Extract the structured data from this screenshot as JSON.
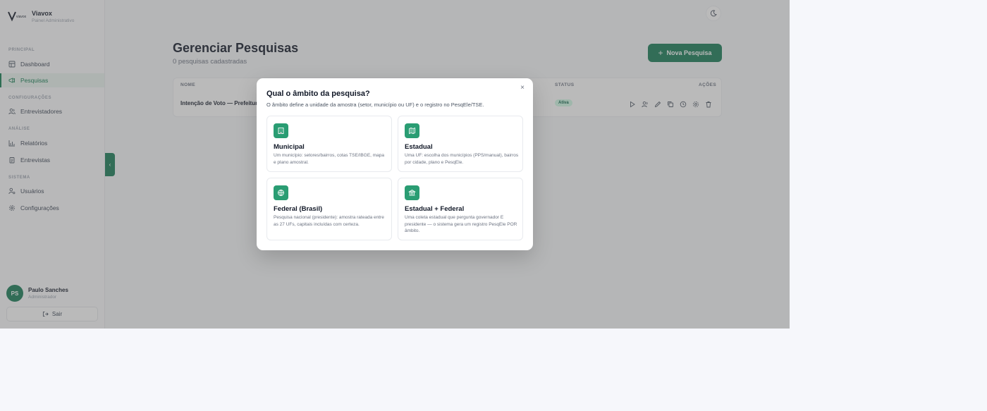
{
  "brand": {
    "name": "Viavox",
    "subtitle": "Painel Administrativo"
  },
  "sidebar": {
    "sections": [
      {
        "label": "PRINCIPAL"
      },
      {
        "label": "CONFIGURAÇÕES"
      },
      {
        "label": "ANÁLISE"
      },
      {
        "label": "SISTEMA"
      }
    ],
    "items": [
      {
        "label": "Dashboard",
        "icon": "dashboard-icon"
      },
      {
        "label": "Pesquisas",
        "icon": "megaphone-icon",
        "active": true
      },
      {
        "label": "Entrevistadores",
        "icon": "users-icon"
      },
      {
        "label": "Relatórios",
        "icon": "bar-chart-icon"
      },
      {
        "label": "Entrevistas",
        "icon": "clipboard-icon"
      },
      {
        "label": "Usuários",
        "icon": "user-cog-icon"
      },
      {
        "label": "Configurações",
        "icon": "gear-icon"
      }
    ],
    "collapse_glyph": "‹"
  },
  "user": {
    "initials": "PS",
    "name": "Paulo Sanches",
    "role": "Administrador"
  },
  "logout": {
    "label": "Sair"
  },
  "header": {
    "theme_icon": "moon-icon"
  },
  "page": {
    "title": "Gerenciar Pesquisas",
    "subtitle": "0 pesquisas cadastradas",
    "new_button": "Nova Pesquisa",
    "new_button_glyph": "+"
  },
  "table": {
    "columns": {
      "name": "NOME",
      "status": "STATUS",
      "actions": "AÇÕES"
    },
    "rows": [
      {
        "name": "Intenção de Voto — Prefeitura",
        "status": "Ativa"
      }
    ]
  },
  "modal": {
    "title": "Qual o âmbito da pesquisa?",
    "description": "O âmbito define a unidade da amostra (setor, município ou UF) e o registro no PesqEle/TSE.",
    "close_glyph": "×",
    "options": [
      {
        "title": "Municipal",
        "icon": "building-icon",
        "description": "Um município: setores/bairros, cotas TSE/IBGE, mapa e plano amostral."
      },
      {
        "title": "Estadual",
        "icon": "map-icon",
        "description": "Uma UF: escolha dos municípios (PPS/manual), bairros por cidade, plano e PesqEle."
      },
      {
        "title": "Federal (Brasil)",
        "icon": "globe-icon",
        "description": "Pesquisa nacional (presidente): amostra rateada entre as 27 UFs, capitais incluídas com certeza."
      },
      {
        "title": "Estadual + Federal",
        "icon": "landmark-icon",
        "description": "Uma coleta estadual que pergunta governador E presidente — o sistema gera um registro PesqEle POR âmbito."
      }
    ]
  },
  "colors": {
    "brand": "#157a55",
    "accent": "#2a9d73"
  }
}
